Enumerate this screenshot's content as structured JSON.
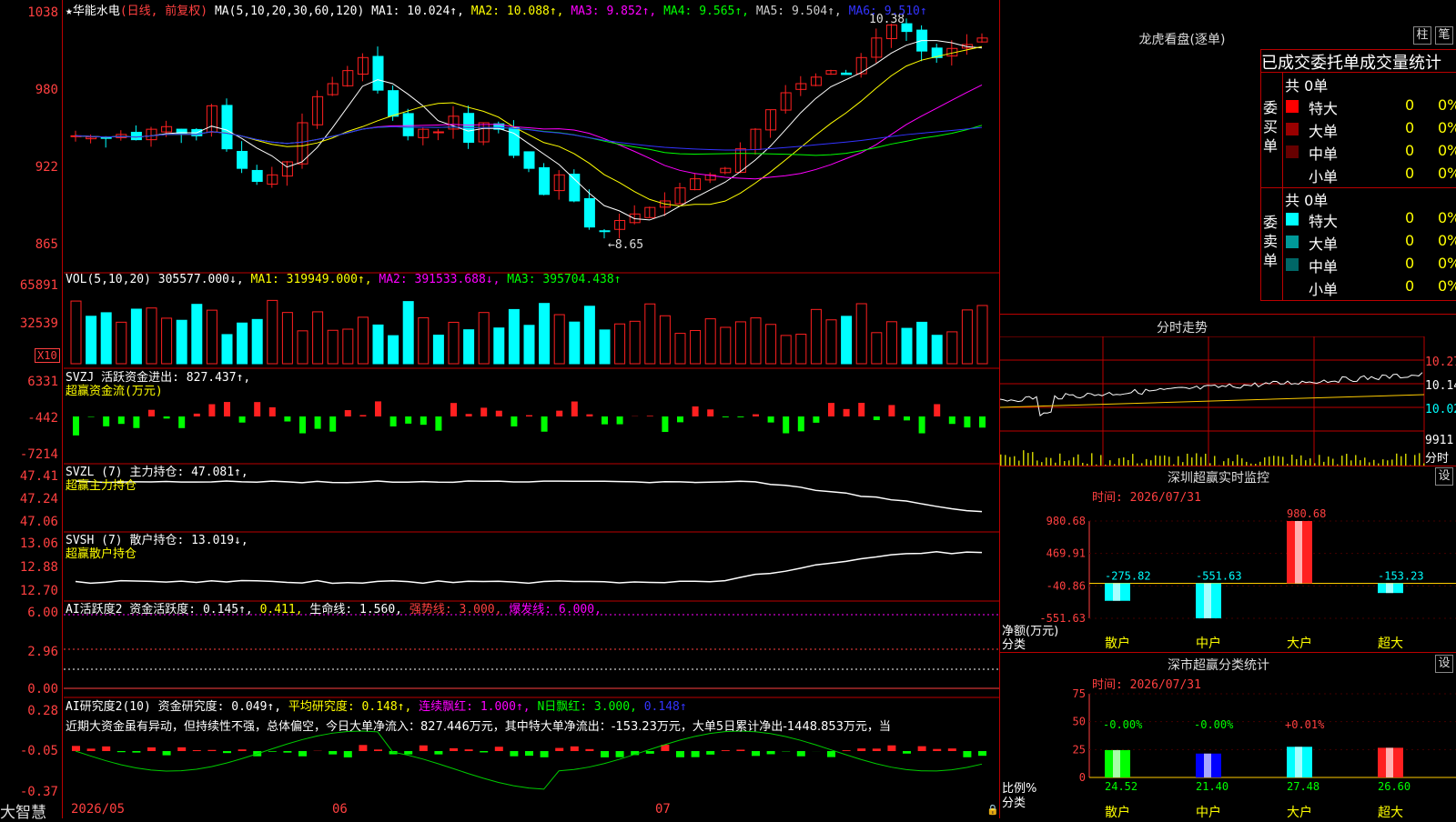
{
  "app": {
    "brand": "大智慧"
  },
  "main_chart": {
    "title": "★华能水电",
    "period": "(日线, 前复权)",
    "ma_label": "MA(5,10,20,30,60,120)",
    "ma": [
      {
        "text": "MA1: 10.024↑,",
        "color": "#ffffff"
      },
      {
        "text": "MA2: 10.088↑,",
        "color": "#ffff00"
      },
      {
        "text": "MA3: 9.852↑,",
        "color": "#ff00ff"
      },
      {
        "text": "MA4: 9.565↑,",
        "color": "#00ff00"
      },
      {
        "text": "MA5: 9.504↑,",
        "color": "#cccccc"
      },
      {
        "text": "MA6: 9.510↑",
        "color": "#3333ff"
      }
    ],
    "y_ticks": [
      "1038",
      "980",
      "922",
      "865"
    ],
    "high_label": "10.38",
    "low_label": "←8.65"
  },
  "volume": {
    "legend": "VOL(5,10,20) 305577.000↓,",
    "ma1": "MA1: 319949.000↑,",
    "ma2": "MA2: 391533.688↓,",
    "ma3": "MA3: 395704.438↑",
    "y_ticks": [
      "65891",
      "32539"
    ],
    "unit": "X10"
  },
  "svzj": {
    "legend": "SVZJ  活跃资金进出: 827.437↑,",
    "sub": "超赢资金流(万元)",
    "y_ticks": [
      "6331",
      "-442",
      "-7214"
    ]
  },
  "svzl": {
    "legend": "SVZL (7) 主力持仓: 47.081↑,",
    "sub": "超赢主力持仓",
    "y_ticks": [
      "47.41",
      "47.24",
      "47.06"
    ]
  },
  "svsh": {
    "legend": "SVSH (7) 散户持仓: 13.019↓,",
    "sub": "超赢散户持仓",
    "y_ticks": [
      "13.06",
      "12.88",
      "12.70"
    ]
  },
  "ai_active": {
    "legend_a": "AI活跃度2 资金活跃度: 0.145↑,",
    "legend_b": "0.411,",
    "legend_c": "生命线: 1.560,",
    "legend_d": "强势线: 3.000,",
    "legend_e": "爆发线: 6.000,",
    "y_ticks": [
      "6.00",
      "2.96",
      "0.00"
    ]
  },
  "ai_research": {
    "legend_a": "AI研究度2(10) 资金研究度: 0.049↑,",
    "legend_b": "平均研究度: 0.148↑,",
    "legend_c": "连续飘红: 1.000↑,",
    "legend_d": "N日飘红: 3.000,",
    "legend_e": "0.148↑",
    "comment": "近期大资金虽有异动，但持续性不强，总体偏空，今日大单净流入：827.446万元，其中特大单净流出：-153.23万元，大单5日累计净出-1448.853万元，当",
    "y_ticks": [
      "0.28",
      "-0.05",
      "-0.37"
    ]
  },
  "x_axis": {
    "labels": [
      "2026/05",
      "06",
      "07"
    ]
  },
  "dragon_tiger": {
    "title": "龙虎看盘(逐单)",
    "btn_zhu": "柱",
    "btn_bi": "笔",
    "subtitle": "已成交委托单成交量统计",
    "buy_label": "委买单",
    "sell_label": "委卖单",
    "buy_total": "共 0单",
    "sell_total": "共 0单",
    "buy_rows": [
      {
        "label": "特大",
        "value": "0",
        "pct": "0%",
        "color": "#ff0000"
      },
      {
        "label": "大单",
        "value": "0",
        "pct": "0%",
        "color": "#990000"
      },
      {
        "label": "中单",
        "value": "0",
        "pct": "0%",
        "color": "#660000"
      },
      {
        "label": "小单",
        "value": "0",
        "pct": "0%",
        "color": "#000000"
      }
    ],
    "sell_rows": [
      {
        "label": "特大",
        "value": "0",
        "pct": "0%",
        "color": "#00ffff"
      },
      {
        "label": "大单",
        "value": "0",
        "pct": "0%",
        "color": "#009999"
      },
      {
        "label": "中单",
        "value": "0",
        "pct": "0%",
        "color": "#006666"
      },
      {
        "label": "小单",
        "value": "0",
        "pct": "0%",
        "color": "#000000"
      }
    ]
  },
  "intraday": {
    "title": "分时走势",
    "y_ticks": [
      "10.27",
      "10.14",
      "10.02"
    ],
    "vol_label": "9911",
    "vol_unit": "分时"
  },
  "sz_monitor": {
    "title": "深圳超赢实时监控",
    "set_btn": "设",
    "time": "时间: 2026/07/31",
    "y_ticks": [
      "980.68",
      "469.91",
      "-40.86",
      "-551.63"
    ],
    "ylabel": "净额(万元)",
    "xlabel": "分类",
    "chart_data": {
      "type": "bar",
      "categories": [
        "散户",
        "中户",
        "大户",
        "超大"
      ],
      "values": [
        -275.82,
        -551.63,
        980.68,
        -153.23
      ],
      "ylim": [
        -551.63,
        980.68
      ]
    }
  },
  "sz_class": {
    "title": "深市超赢分类统计",
    "set_btn": "设",
    "time": "时间: 2026/07/31",
    "y_ticks": [
      "75",
      "50",
      "25",
      "0"
    ],
    "ylabel": "比例%",
    "xlabel": "分类",
    "chart_data": {
      "type": "bar",
      "categories": [
        "散户",
        "中户",
        "大户",
        "超大"
      ],
      "values": [
        24.52,
        21.4,
        27.48,
        26.6
      ],
      "changes": [
        "-0.00%",
        "-0.00%",
        "+0.01%",
        ""
      ],
      "ylim": [
        0,
        75
      ]
    }
  },
  "colors": {
    "up": "#ff2020",
    "down": "#00ffff",
    "grid": "#b00000"
  }
}
